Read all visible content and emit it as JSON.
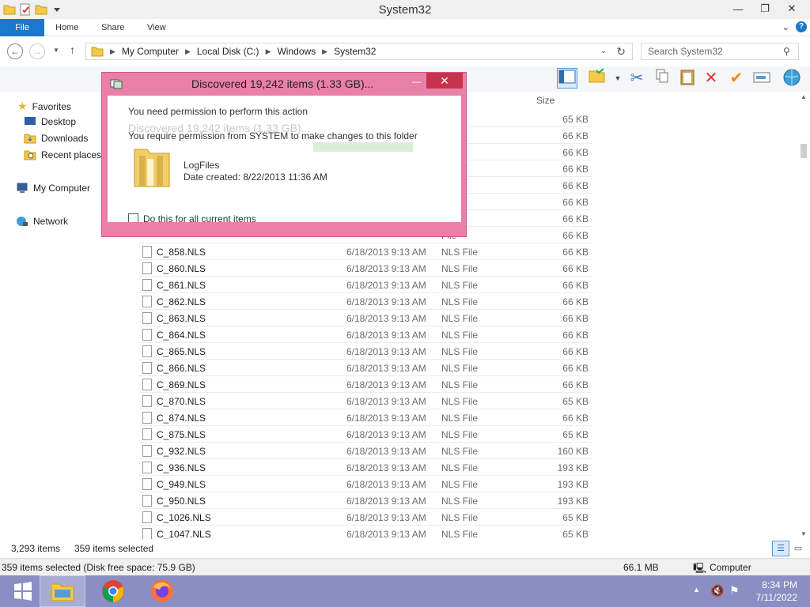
{
  "window": {
    "title": "System32",
    "buttons": {
      "minimize": "—",
      "maximize": "❐",
      "close": "✕"
    }
  },
  "ribbon": {
    "tabs": [
      "File",
      "Home",
      "Share",
      "View"
    ],
    "expand": "⌄"
  },
  "address": {
    "crumbs": [
      "My Computer",
      "Local Disk (C:)",
      "Windows",
      "System32"
    ],
    "search_placeholder": "Search System32"
  },
  "nav": {
    "favorites": "Favorites",
    "desktop": "Desktop",
    "downloads": "Downloads",
    "recent": "Recent places",
    "computer": "My Computer",
    "network": "Network"
  },
  "columns": {
    "size": "Size"
  },
  "files_partial": [
    {
      "size": "65 KB"
    },
    {
      "size": "66 KB"
    },
    {
      "size": "66 KB"
    },
    {
      "size": "66 KB"
    },
    {
      "size": "66 KB"
    },
    {
      "size": "66 KB"
    },
    {
      "size": "66 KB"
    },
    {
      "size": "66 KB"
    }
  ],
  "partial_type": "File",
  "files": [
    {
      "name": "C_858.NLS",
      "date": "6/18/2013 9:13 AM",
      "type": "NLS File",
      "size": "66 KB"
    },
    {
      "name": "C_860.NLS",
      "date": "6/18/2013 9:13 AM",
      "type": "NLS File",
      "size": "66 KB"
    },
    {
      "name": "C_861.NLS",
      "date": "6/18/2013 9:13 AM",
      "type": "NLS File",
      "size": "66 KB"
    },
    {
      "name": "C_862.NLS",
      "date": "6/18/2013 9:13 AM",
      "type": "NLS File",
      "size": "66 KB"
    },
    {
      "name": "C_863.NLS",
      "date": "6/18/2013 9:13 AM",
      "type": "NLS File",
      "size": "66 KB"
    },
    {
      "name": "C_864.NLS",
      "date": "6/18/2013 9:13 AM",
      "type": "NLS File",
      "size": "66 KB"
    },
    {
      "name": "C_865.NLS",
      "date": "6/18/2013 9:13 AM",
      "type": "NLS File",
      "size": "66 KB"
    },
    {
      "name": "C_866.NLS",
      "date": "6/18/2013 9:13 AM",
      "type": "NLS File",
      "size": "66 KB"
    },
    {
      "name": "C_869.NLS",
      "date": "6/18/2013 9:13 AM",
      "type": "NLS File",
      "size": "66 KB"
    },
    {
      "name": "C_870.NLS",
      "date": "6/18/2013 9:13 AM",
      "type": "NLS File",
      "size": "65 KB"
    },
    {
      "name": "C_874.NLS",
      "date": "6/18/2013 9:13 AM",
      "type": "NLS File",
      "size": "66 KB"
    },
    {
      "name": "C_875.NLS",
      "date": "6/18/2013 9:13 AM",
      "type": "NLS File",
      "size": "65 KB"
    },
    {
      "name": "C_932.NLS",
      "date": "6/18/2013 9:13 AM",
      "type": "NLS File",
      "size": "160 KB"
    },
    {
      "name": "C_936.NLS",
      "date": "6/18/2013 9:13 AM",
      "type": "NLS File",
      "size": "193 KB"
    },
    {
      "name": "C_949.NLS",
      "date": "6/18/2013 9:13 AM",
      "type": "NLS File",
      "size": "193 KB"
    },
    {
      "name": "C_950.NLS",
      "date": "6/18/2013 9:13 AM",
      "type": "NLS File",
      "size": "193 KB"
    },
    {
      "name": "C_1026.NLS",
      "date": "6/18/2013 9:13 AM",
      "type": "NLS File",
      "size": "65 KB"
    },
    {
      "name": "C_1047.NLS",
      "date": "6/18/2013 9:13 AM",
      "type": "NLS File",
      "size": "65 KB"
    }
  ],
  "status": {
    "item_count": "3,293 items",
    "selected": "359 items selected",
    "detail": "359 items selected (Disk free space: 75.9 GB)",
    "size": "66.1 MB",
    "location": "Computer"
  },
  "dialog": {
    "title": "Discovered 19,242 items (1.33 GB)...",
    "line1": "You need permission to perform this action",
    "ghost": "Discovered 19,242 items (1.33 GB)...",
    "line2": "You require permission from SYSTEM to make changes to this folder",
    "folder_name": "LogFiles",
    "date_created": "Date created: 8/22/2013 11:36 AM",
    "checkbox_label": "Do this for all current items",
    "minimize": "—",
    "close": "✕"
  },
  "taskbar": {
    "time": "8:34 PM",
    "date": "7/11/2022"
  },
  "colors": {
    "accent": "#1979ca",
    "dialog_frame": "#e880a8",
    "close_red": "#c7334d",
    "taskbar": "#8a8ec2"
  }
}
